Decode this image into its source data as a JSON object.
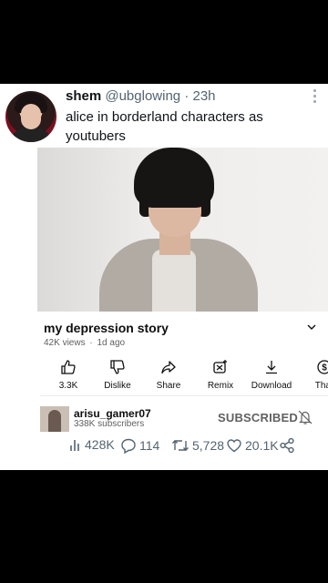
{
  "tweet": {
    "name": "shem",
    "handle": "@ubglowing",
    "separator": "·",
    "time": "23h",
    "text": "alice in borderland characters as youtubers"
  },
  "youtube": {
    "video_title": "my depression story",
    "views": "42K views",
    "dot": "·",
    "posted": "1d ago",
    "actions": [
      {
        "label": "3.3K",
        "icon": "thumbs-up-icon"
      },
      {
        "label": "Dislike",
        "icon": "thumbs-down-icon"
      },
      {
        "label": "Share",
        "icon": "share-icon"
      },
      {
        "label": "Remix",
        "icon": "remix-icon"
      },
      {
        "label": "Download",
        "icon": "download-icon"
      },
      {
        "label": "Thar",
        "icon": "thanks-icon"
      }
    ],
    "channel_name": "arisu_gamer07",
    "channel_subs": "338K subscribers",
    "subscribe_label": "SUBSCRIBED"
  },
  "stats": {
    "views": "428K",
    "replies": "114",
    "retweets": "5,728",
    "likes": "20.1K"
  },
  "colors": {
    "background": "#000000",
    "card": "#ffffff",
    "muted": "#536471"
  }
}
